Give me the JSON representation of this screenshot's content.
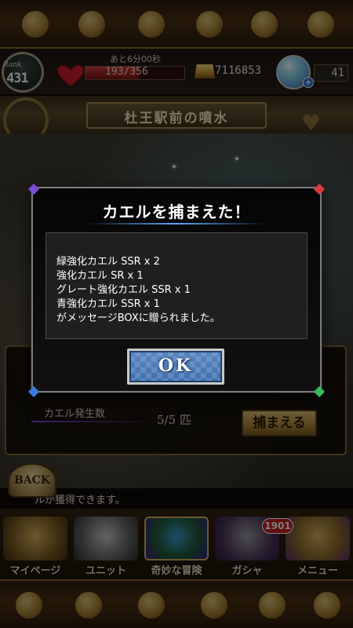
{
  "header": {
    "rank_label": "Rank",
    "rank_value": "431",
    "stamina_timer": "あと6分00秒",
    "stamina_text": "193/356",
    "stamina_ratio": 0.542,
    "gold": "7116853",
    "jewels": "41"
  },
  "location": {
    "title": "杜王駅前の噴水"
  },
  "hunt_panel": {
    "frog_label": "カエル発生数",
    "frog_count": "5/5 匹",
    "catch_button": "捕まえる"
  },
  "ticker": {
    "back_label": "BACK",
    "text": "ルが獲得できます。"
  },
  "nav": {
    "items": [
      {
        "label": "マイページ"
      },
      {
        "label": "ユニット"
      },
      {
        "label": "奇妙な冒険"
      },
      {
        "label": "ガシャ"
      },
      {
        "label": "メニュー"
      }
    ],
    "gacha_badge": "1901"
  },
  "dialog": {
    "title": "カエルを捕まえた！",
    "lines": [
      "緑強化カエル SSR x 2",
      "強化カエル SR x 1",
      "グレート強化カエル SSR x 1",
      "青強化カエル SSR x 1",
      "がメッセージBOXに贈られました。"
    ],
    "ok_label": "OK"
  },
  "colors": {
    "accent_blue": "#59a8ff",
    "ok_button": "#4a7ab8",
    "stamina_red": "#d23a3a",
    "gold_trim": "#a88b4e"
  }
}
